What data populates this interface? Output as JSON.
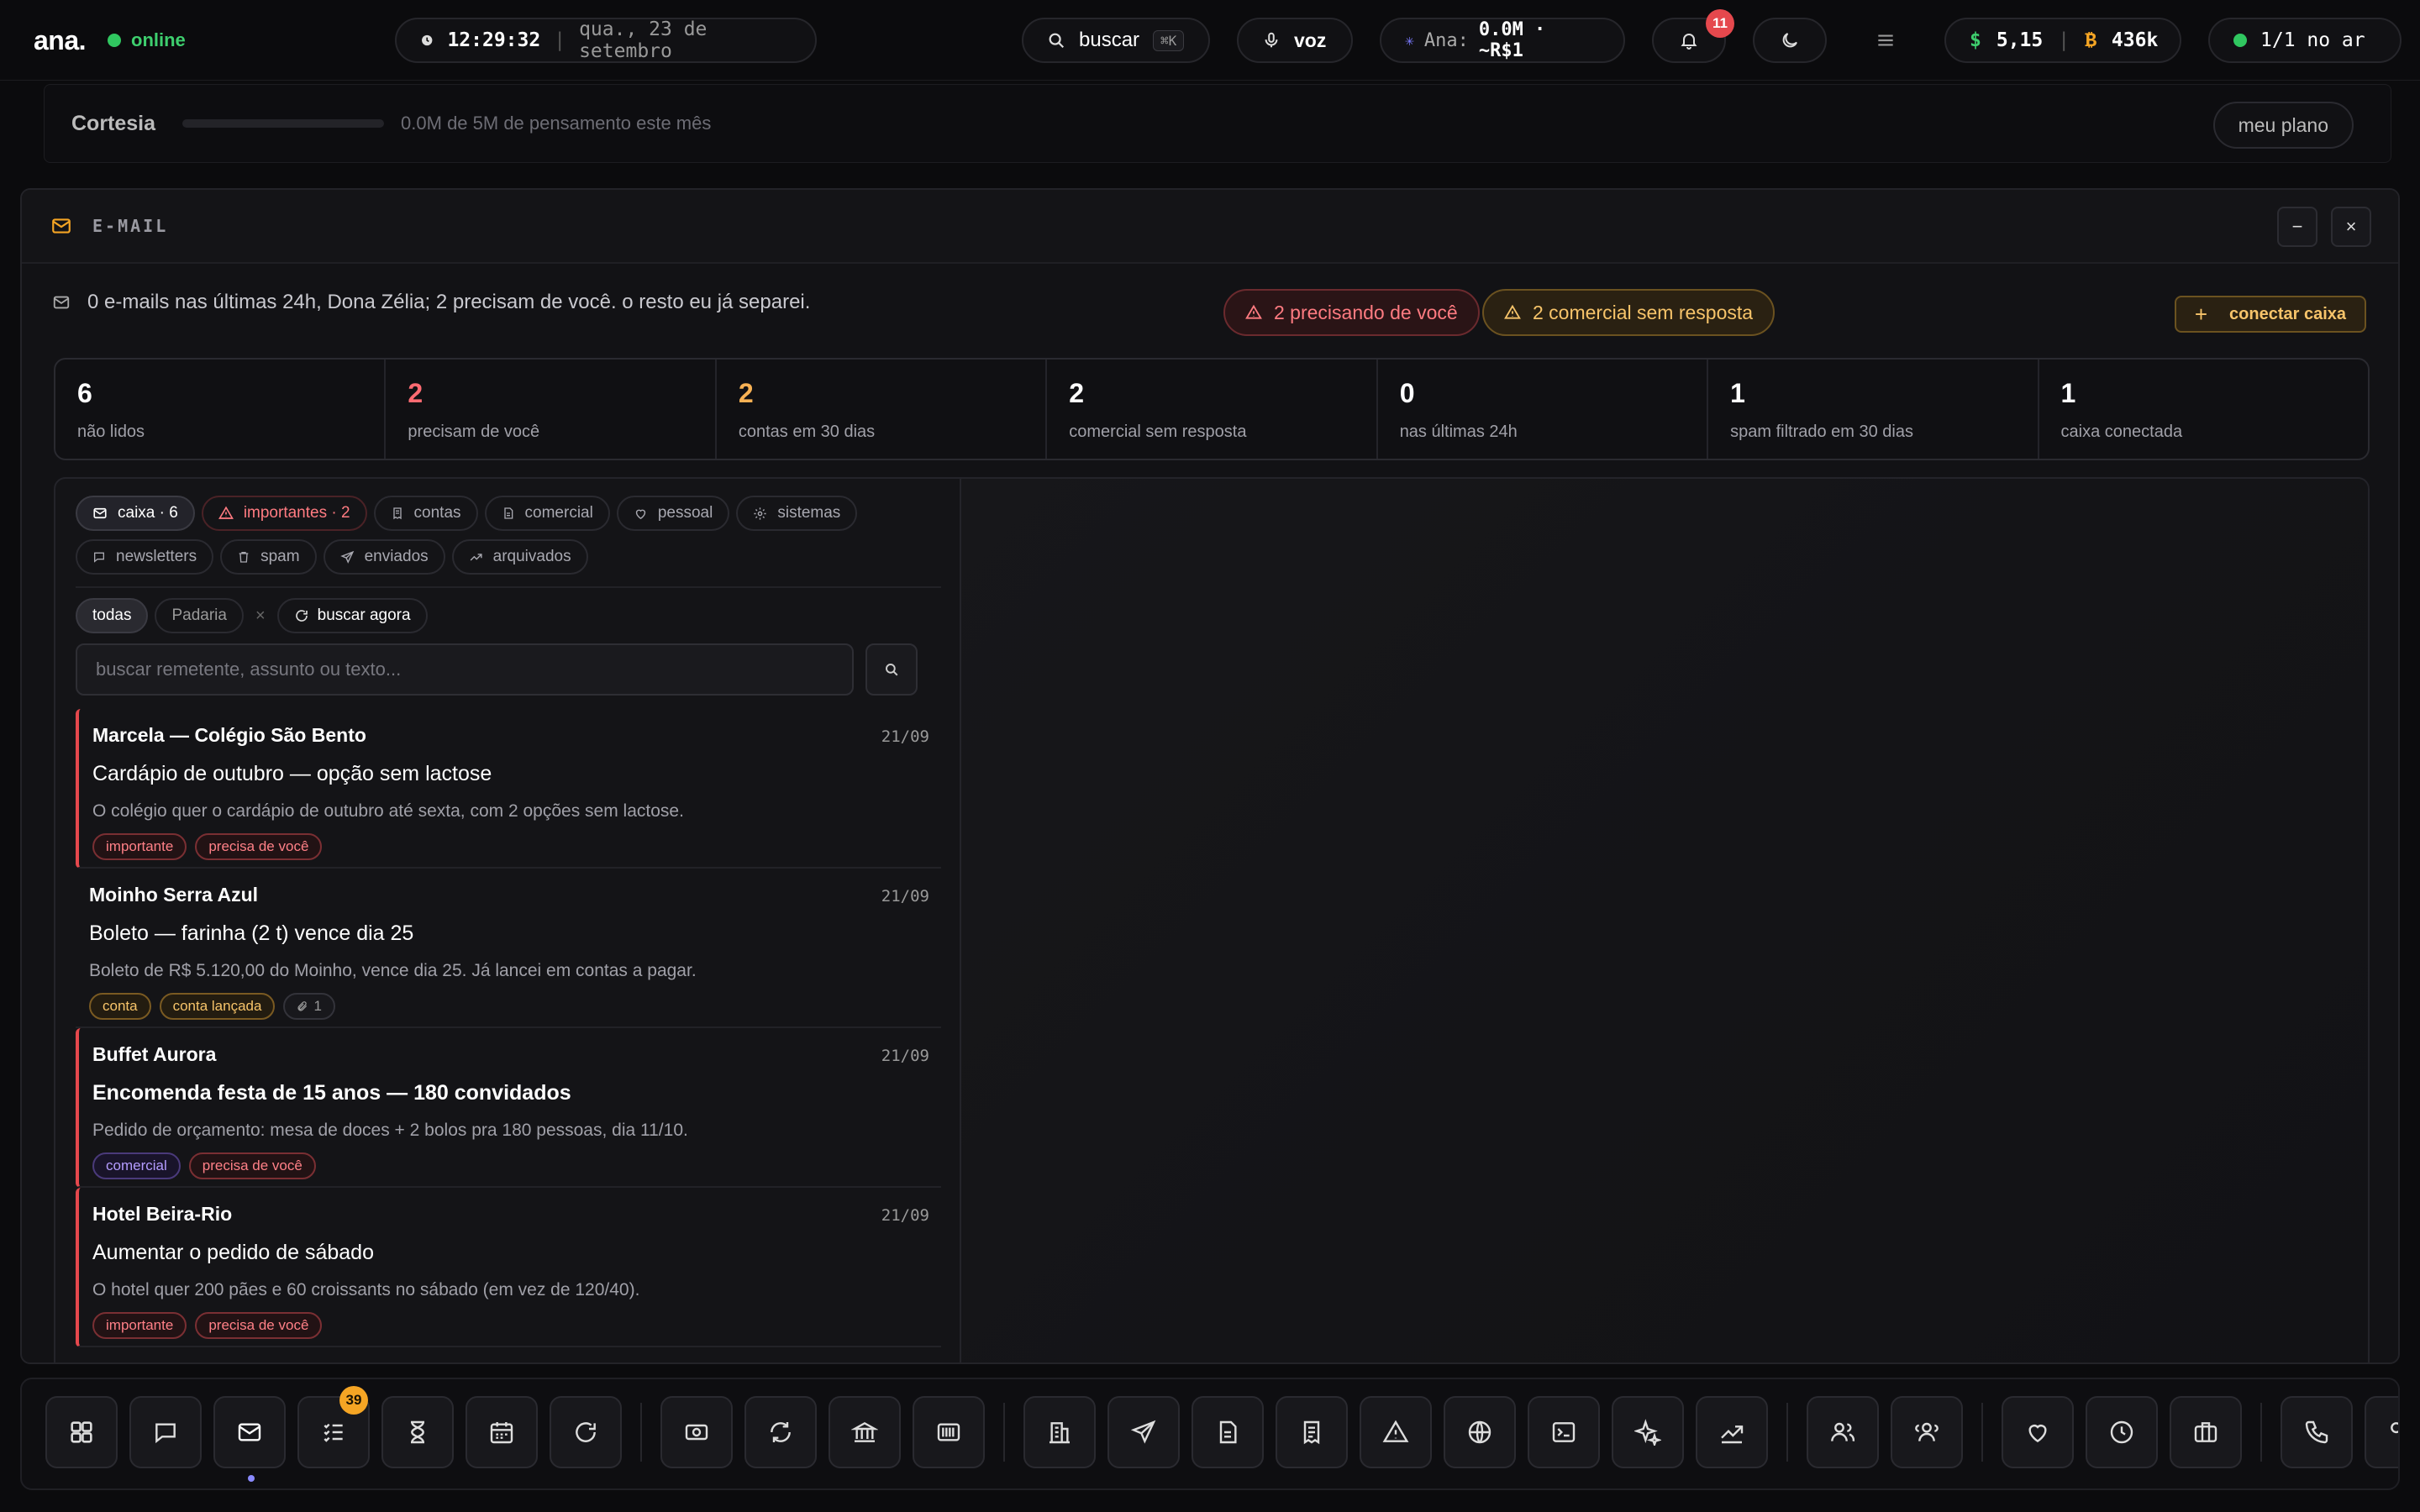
{
  "topbar": {
    "logo": "ana.",
    "status": "online",
    "time": "12:29:32",
    "date": "qua., 23 de setembro",
    "search_label": "buscar",
    "search_shortcut": "⌘K",
    "voice_label": "voz",
    "ana_label": "Ana:",
    "ana_value": "0.0M · ~R$1",
    "notifications_count": "11",
    "balance_usd": "5,15",
    "balance_btc": "436k",
    "air_status": "1/1 no ar"
  },
  "cortesia": {
    "title": "Cortesia",
    "usage_fraction": 0,
    "usage_text": "0.0M de 5M de pensamento este mês",
    "plan_button": "meu plano"
  },
  "email": {
    "window_title": "E-MAIL",
    "minimize": "−",
    "close": "×",
    "summary": "0 e-mails nas últimas 24h, Dona Zélia; 2 precisam de você. o resto eu já separei.",
    "alert_needs_you": "2 precisando de você",
    "alert_commercial": "2 comercial sem resposta",
    "connect_button": "conectar caixa",
    "stats": [
      {
        "value": "6",
        "label": "não lidos"
      },
      {
        "value": "2",
        "label": "precisam de você"
      },
      {
        "value": "2",
        "label": "contas em 30 dias"
      },
      {
        "value": "2",
        "label": "comercial sem resposta"
      },
      {
        "value": "0",
        "label": "nas últimas 24h"
      },
      {
        "value": "1",
        "label": "spam filtrado em 30 dias"
      },
      {
        "value": "1",
        "label": "caixa conectada"
      }
    ],
    "folders": [
      {
        "label": "caixa · 6",
        "icon": "mail-icon"
      },
      {
        "label": "importantes · 2",
        "icon": "alert-icon"
      },
      {
        "label": "contas",
        "icon": "receipt-icon"
      },
      {
        "label": "comercial",
        "icon": "document-icon"
      },
      {
        "label": "pessoal",
        "icon": "heart-icon"
      },
      {
        "label": "sistemas",
        "icon": "gear-icon"
      },
      {
        "label": "newsletters",
        "icon": "newsletter-icon"
      },
      {
        "label": "spam",
        "icon": "trash-icon"
      },
      {
        "label": "enviados",
        "icon": "send-icon"
      },
      {
        "label": "arquivados",
        "icon": "archive-icon"
      }
    ],
    "filters": {
      "all": "todas",
      "account": "Padaria",
      "remove": "×",
      "search_now": "buscar agora"
    },
    "search_placeholder": "buscar remetente, assunto ou texto...",
    "messages": [
      {
        "from": "Marcela — Colégio São Bento",
        "date": "21/09",
        "subject": "Cardápio de outubro — opção sem lactose",
        "preview": "O colégio quer o cardápio de outubro até sexta, com 2 opções sem lactose.",
        "tags": [
          "importante",
          "precisa de você"
        ]
      },
      {
        "from": "Moinho Serra Azul",
        "date": "21/09",
        "subject": "Boleto — farinha (2 t) vence dia 25",
        "preview": "Boleto de R$ 5.120,00 do Moinho, vence dia 25. Já lancei em contas a pagar.",
        "tags": [
          "conta",
          "conta lançada"
        ],
        "attachments": "1"
      },
      {
        "from": "Buffet Aurora",
        "date": "21/09",
        "subject": "Encomenda festa de 15 anos — 180 convidados",
        "preview": "Pedido de orçamento: mesa de doces + 2 bolos pra 180 pessoas, dia 11/10.",
        "tags": [
          "comercial",
          "precisa de você"
        ]
      },
      {
        "from": "Hotel Beira-Rio",
        "date": "21/09",
        "subject": "Aumentar o pedido de sábado",
        "preview": "O hotel quer 200 pães e 60 croissants no sábado (em vez de 120/40).",
        "tags": [
          "importante",
          "precisa de você"
        ]
      }
    ]
  },
  "dock": {
    "tasks_badge": "39"
  }
}
